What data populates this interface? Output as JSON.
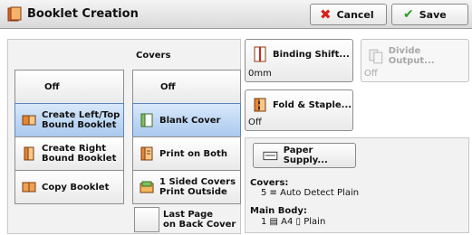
{
  "window": {
    "title": "Booklet Creation"
  },
  "toolbar": {
    "cancel_label": "Cancel",
    "save_label": "Save"
  },
  "options": {
    "off": "Off",
    "left_top": [
      "Create Left/Top",
      "Bound Booklet"
    ],
    "right": [
      "Create Right",
      "Bound Booklet"
    ],
    "copy": "Copy Booklet"
  },
  "covers": {
    "label": "Covers",
    "off": "Off",
    "blank": "Blank Cover",
    "print_both": "Print on Both",
    "one_sided": [
      "1 Sided Covers",
      "Print Outside"
    ],
    "last_page": [
      "Last Page",
      "on Back Cover"
    ]
  },
  "binding": {
    "label": "Binding Shift...",
    "value": "0mm"
  },
  "divide": {
    "label": "Divide Output...",
    "value": "Off"
  },
  "fold": {
    "label": "Fold & Staple...",
    "value": "Off"
  },
  "paper_supply": {
    "button_label": "Paper Supply...",
    "covers_label": "Covers:",
    "covers_value": "5 ≡ Auto Detect Plain",
    "main_body_label": "Main Body:",
    "main_body_value": "1 ▤ A4 ▯ Plain"
  },
  "colors": {
    "selected_fill": "#a9c9ee",
    "selected_border": "#5b86bd",
    "cancel_icon": "#d4231a",
    "save_icon": "#2f9a2a"
  },
  "selection": {
    "booklet": "left_top",
    "covers": "blank"
  }
}
